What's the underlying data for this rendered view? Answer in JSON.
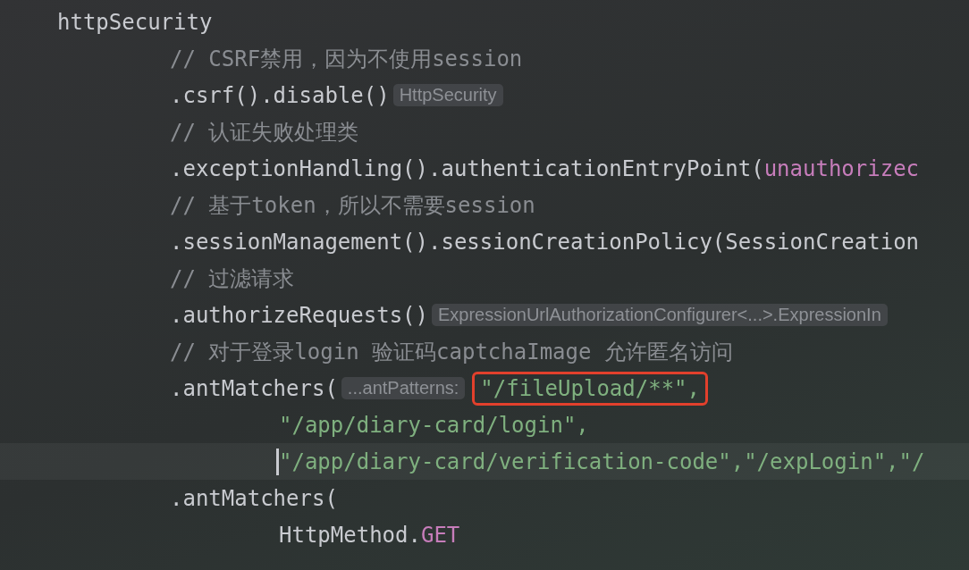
{
  "editor": {
    "lines": [
      {
        "kind": "root",
        "current": false,
        "tokens": [
          {
            "kind": "code",
            "text": "httpSecurity"
          }
        ]
      },
      {
        "kind": "chain",
        "current": false,
        "tokens": [
          {
            "kind": "comment",
            "text": "// CSRF禁用，因为不使用session"
          }
        ]
      },
      {
        "kind": "chain",
        "current": false,
        "tokens": [
          {
            "kind": "code",
            "text": ".csrf().disable()"
          },
          {
            "kind": "hint",
            "text": "HttpSecurity"
          }
        ]
      },
      {
        "kind": "chain",
        "current": false,
        "tokens": [
          {
            "kind": "comment",
            "text": "// 认证失败处理类"
          }
        ]
      },
      {
        "kind": "chain",
        "current": false,
        "tokens": [
          {
            "kind": "code",
            "text": ".exceptionHandling().authenticationEntryPoint("
          },
          {
            "kind": "field",
            "text": "unauthorizec"
          }
        ]
      },
      {
        "kind": "chain",
        "current": false,
        "tokens": [
          {
            "kind": "comment",
            "text": "// 基于token，所以不需要session"
          }
        ]
      },
      {
        "kind": "chain",
        "current": false,
        "tokens": [
          {
            "kind": "code",
            "text": ".sessionManagement().sessionCreationPolicy(SessionCreation"
          }
        ]
      },
      {
        "kind": "chain",
        "current": false,
        "tokens": [
          {
            "kind": "comment",
            "text": "// 过滤请求"
          }
        ]
      },
      {
        "kind": "chain",
        "current": false,
        "tokens": [
          {
            "kind": "code",
            "text": ".authorizeRequests()"
          },
          {
            "kind": "hint",
            "text": "ExpressionUrlAuthorizationConfigurer<...>.ExpressionIn"
          }
        ]
      },
      {
        "kind": "chain",
        "current": false,
        "tokens": [
          {
            "kind": "comment",
            "text": "// 对于登录login 验证码captchaImage 允许匿名访问"
          }
        ]
      },
      {
        "kind": "chain",
        "current": false,
        "tokens": [
          {
            "kind": "code",
            "text": ".antMatchers("
          },
          {
            "kind": "hint",
            "text": "...antPatterns:"
          },
          {
            "kind": "string",
            "text": "\"/fileUpload/**\",",
            "highlighted": true
          }
        ]
      },
      {
        "kind": "argument",
        "current": false,
        "tokens": [
          {
            "kind": "string",
            "text": "\"/app/diary-card/login\","
          }
        ]
      },
      {
        "kind": "argument",
        "current": true,
        "tokens": [
          {
            "kind": "string",
            "text": "\"/app/diary-card/verification-code\",\"/expLogin\",\"/"
          }
        ]
      },
      {
        "kind": "chain",
        "current": false,
        "tokens": [
          {
            "kind": "code",
            "text": ".antMatchers("
          }
        ]
      },
      {
        "kind": "argument",
        "current": false,
        "tokens": [
          {
            "kind": "code",
            "text": "HttpMethod."
          },
          {
            "kind": "field",
            "text": "GET"
          }
        ]
      }
    ]
  }
}
